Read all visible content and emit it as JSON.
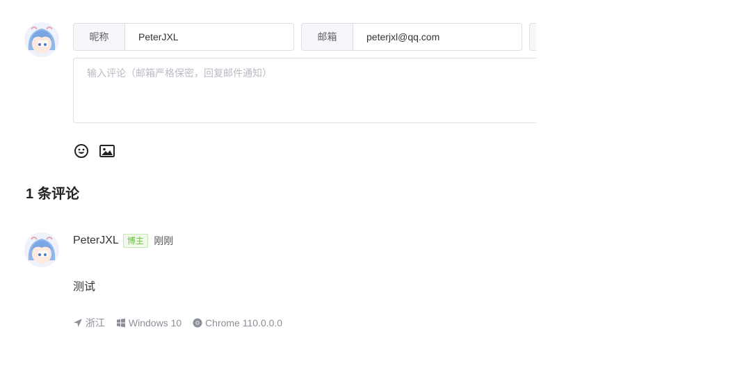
{
  "form": {
    "nickname": {
      "label": "昵称",
      "value": "PeterJXL"
    },
    "email": {
      "label": "邮箱",
      "value": "peterjxl@qq.com"
    },
    "comment_placeholder": "输入评论（邮箱严格保密，回复邮件通知）",
    "tools": [
      "emoji-icon",
      "image-icon"
    ]
  },
  "comments_section": {
    "count": "1",
    "count_label": "条评论"
  },
  "comment": {
    "author": "PeterJXL",
    "badge": "博主",
    "time": "刚刚",
    "content": "测试",
    "location": "浙江",
    "os": "Windows 10",
    "browser": "Chrome 110.0.0.0"
  },
  "colors": {
    "badge_text": "#67c23a",
    "badge_bg": "#f0f9eb",
    "border": "#dcdfe6",
    "prefix_bg": "#f5f7fa"
  }
}
